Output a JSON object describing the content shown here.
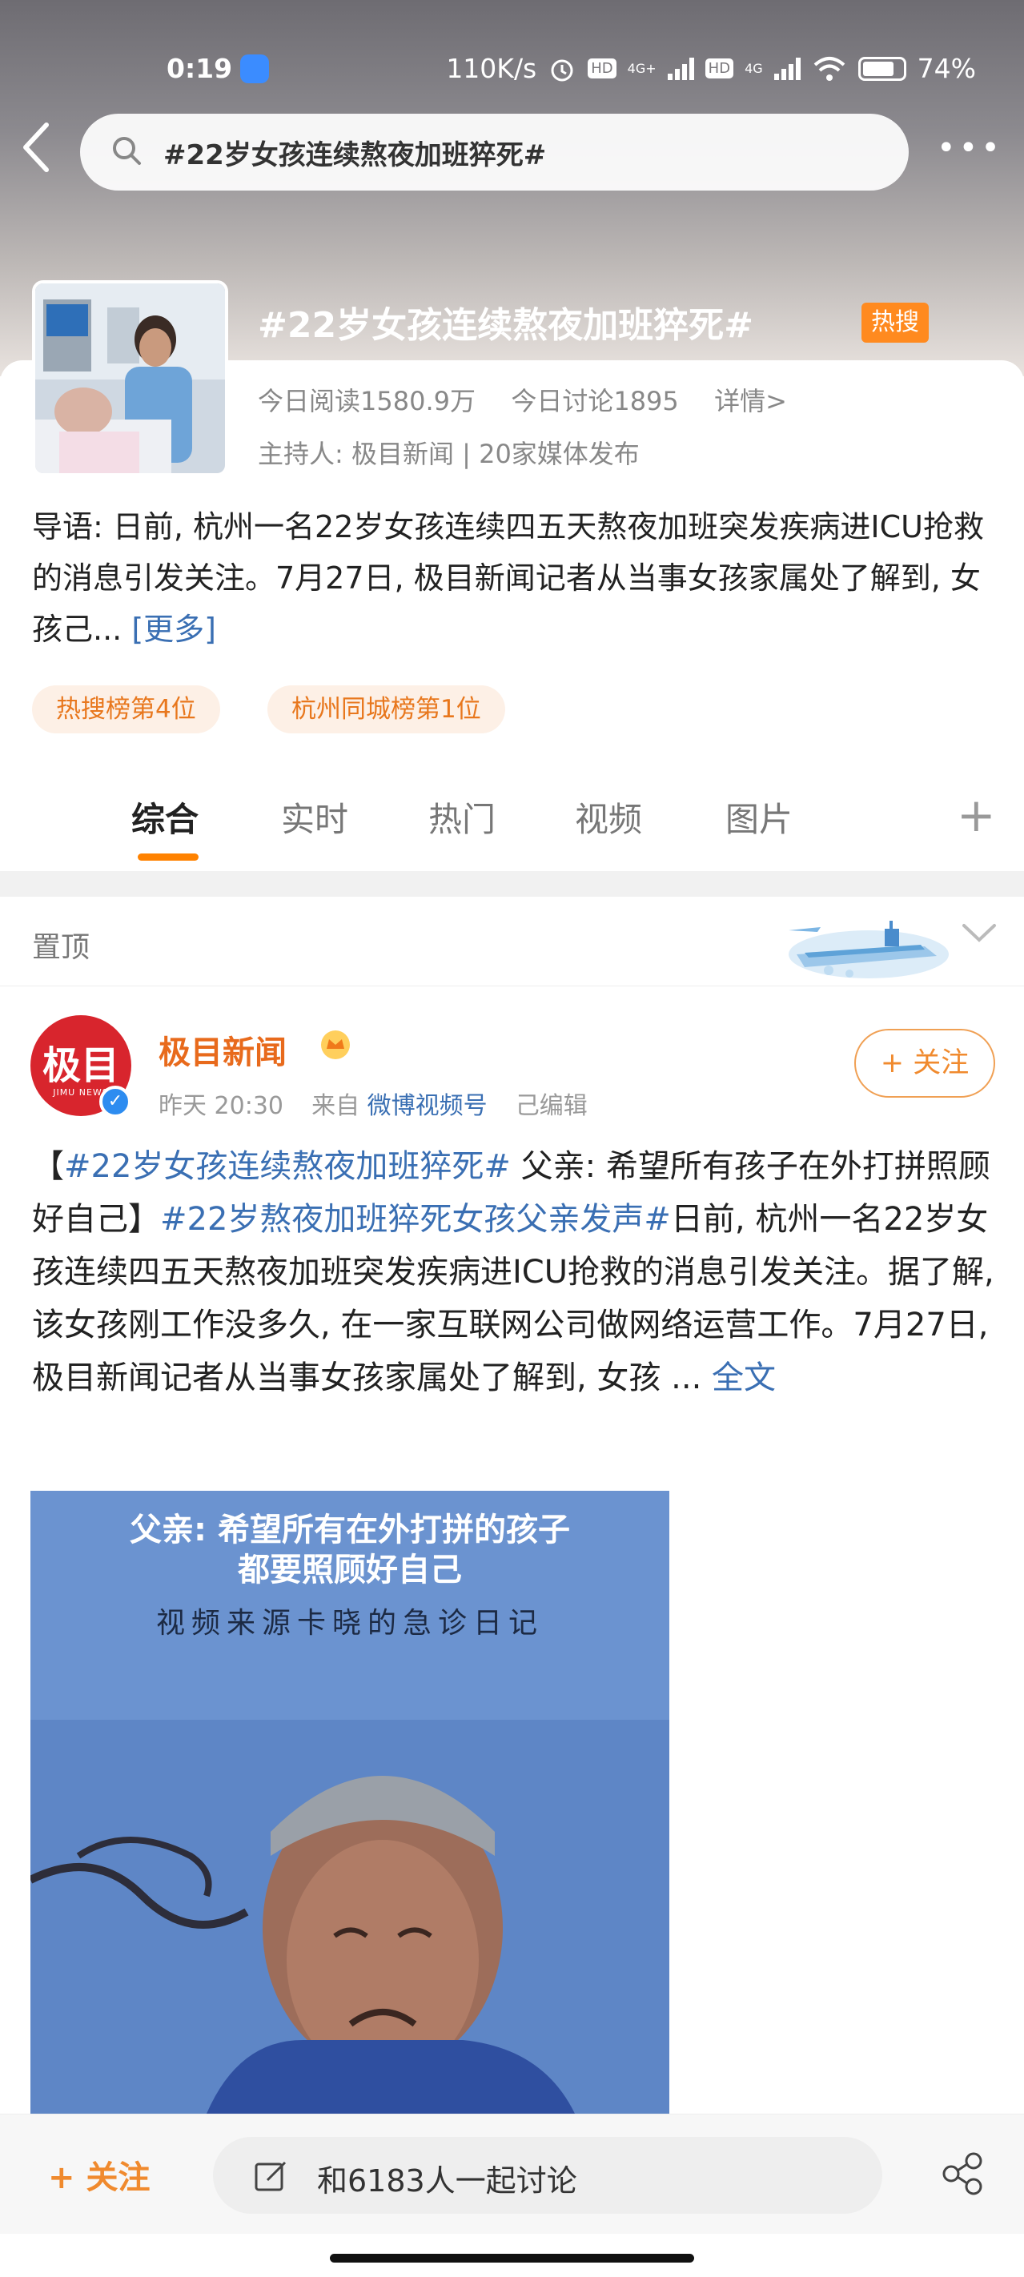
{
  "status_bar": {
    "time": "0:19",
    "network_speed": "110K/s",
    "hd1": "HD",
    "net1": "4G+",
    "hd2": "HD",
    "net2": "4G",
    "battery": "74%"
  },
  "search": {
    "query": "#22岁女孩连续熬夜加班猝死#"
  },
  "topic": {
    "title": "#22岁女孩连续熬夜加班猝死#",
    "hot_badge": "热搜",
    "reads": "今日阅读1580.9万",
    "discussions": "今日讨论1895",
    "details": "详情>",
    "host": "主持人: 极目新闻 | 20家媒体发布",
    "intro": "导语: 日前, 杭州一名22岁女孩连续四五天熬夜加班突发疾病进ICU抢救的消息引发关注。7月27日, 极目新闻记者从当事女孩家属处了解到, 女孩己...",
    "intro_more": "[更多]",
    "rank_tags": [
      "热搜榜第4位",
      "杭州同城榜第1位"
    ]
  },
  "tabs": [
    "综合",
    "实时",
    "热门",
    "视频",
    "图片"
  ],
  "active_tab": "综合",
  "pinned": {
    "label": "置顶"
  },
  "post": {
    "author": "极目新闻",
    "avatar_text": "极目",
    "avatar_sub": "JIMU NEWS",
    "time": "昨天 20:30",
    "from_label": "来自",
    "source": "微博视频号",
    "edited": "己编辑",
    "follow_label": "+ 关注",
    "text_open": "【",
    "hashtag1": "#22岁女孩连续熬夜加班猝死#",
    "text1": " 父亲: 希望所有孩子在外打拼照顾好自己】",
    "hashtag2": "#22岁熬夜加班猝死女孩父亲发声#",
    "text2": "日前, 杭州一名22岁女孩连续四五天熬夜加班突发疾病进ICU抢救的消息引发关注。据了解, 该女孩刚工作没多久, 在一家互联网公司做网络运营工作。7月27日, 极目新闻记者从当事女孩家属处了解到, 女孩 ...",
    "full_text": "全文",
    "video": {
      "caption_line1": "父亲: 希望所有在外打拼的孩子",
      "caption_line2": "都要照顾好自己",
      "source_line": "视频来源卡晓的急诊日记"
    }
  },
  "bottom_bar": {
    "follow": "+ 关注",
    "discuss": "和6183人一起讨论"
  }
}
